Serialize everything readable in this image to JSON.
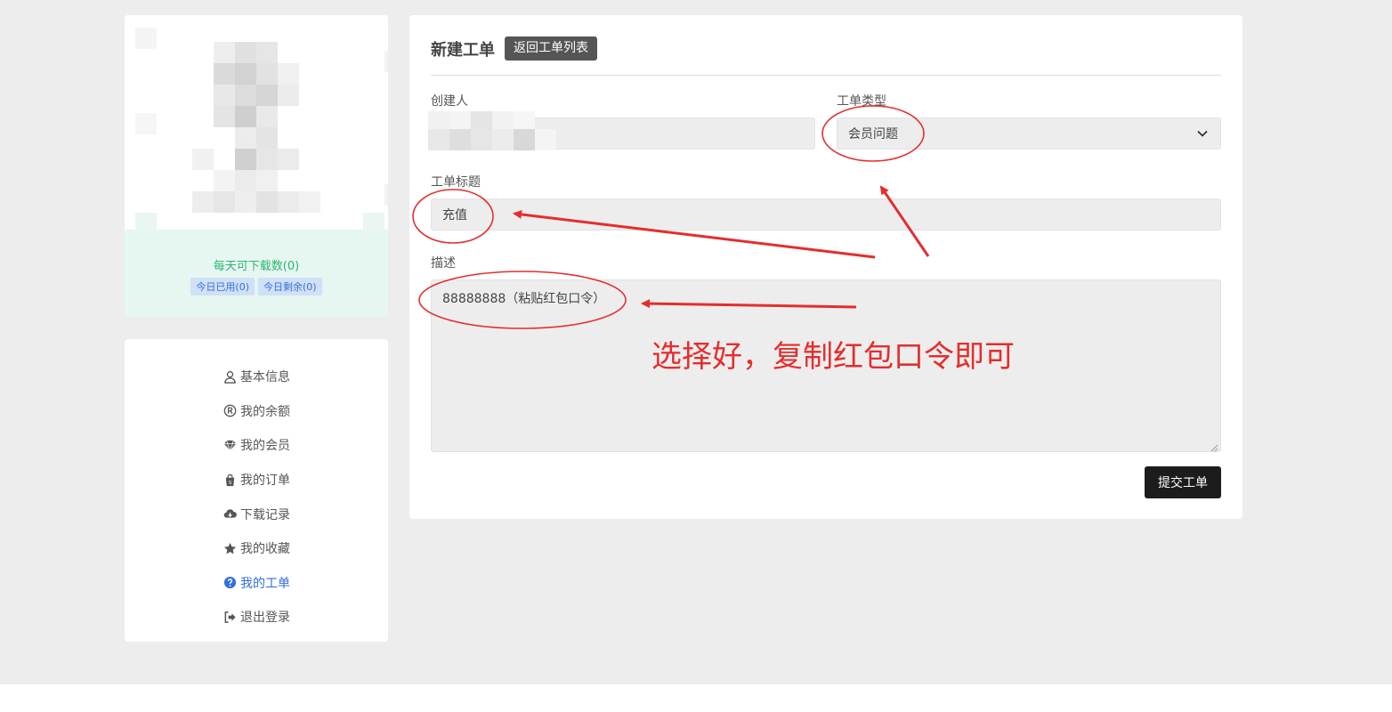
{
  "sidebar": {
    "quota_text": "每天可下载数(0)",
    "badge_used": "今日已用(0)",
    "badge_left": "今日剩余(0)",
    "menu": [
      {
        "label": "基本信息",
        "icon": "user-icon"
      },
      {
        "label": "我的余额",
        "icon": "registered-icon"
      },
      {
        "label": "我的会员",
        "icon": "diamond-icon"
      },
      {
        "label": "我的订单",
        "icon": "shopping-bag-icon"
      },
      {
        "label": "下载记录",
        "icon": "cloud-download-icon"
      },
      {
        "label": "我的收藏",
        "icon": "star-icon"
      },
      {
        "label": "我的工单",
        "icon": "question-circle-icon"
      },
      {
        "label": "退出登录",
        "icon": "sign-out-icon"
      }
    ],
    "active_index": 6
  },
  "form": {
    "title": "新建工单",
    "back_label": "返回工单列表",
    "creator_label": "创建人",
    "type_label": "工单类型",
    "type_value": "会员问题",
    "subject_label": "工单标题",
    "subject_value": "充值",
    "desc_label": "描述",
    "desc_value": "88888888（粘贴红包口令）",
    "submit_label": "提交工单"
  },
  "annotation": {
    "text": "选择好，复制红包口令即可",
    "color": "#e52d2d"
  },
  "colors": {
    "page_bg": "#ededed",
    "quota_green": "#2bb673",
    "active_blue": "#2f6fe0",
    "button_dark": "#1c1c1c"
  }
}
